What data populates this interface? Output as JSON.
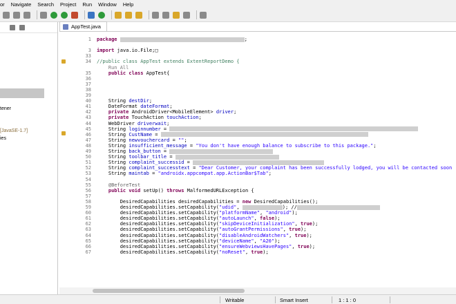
{
  "menu": [
    "or",
    "Navigate",
    "Search",
    "Project",
    "Run",
    "Window",
    "Help"
  ],
  "left_pane": {
    "items": [
      "tener",
      "[JavaSE-1.7]",
      "ies"
    ]
  },
  "editor": {
    "tab_label": "AppTest.java",
    "lines": [
      {
        "n": "1",
        "segs": [
          [
            "kw",
            "package"
          ],
          [
            "plain",
            " "
          ],
          [
            "blur",
            "180"
          ],
          [
            "plain",
            ";"
          ]
        ]
      },
      {
        "n": "",
        "segs": []
      },
      {
        "n": "3",
        "segs": [
          [
            "kw",
            "import"
          ],
          [
            "plain",
            " java.io.File;"
          ],
          [
            "plain",
            "□"
          ]
        ]
      },
      {
        "n": "33",
        "segs": []
      },
      {
        "n": "34",
        "segs": [
          [
            "com",
            "//public class AppTest extends ExtentReportDemo {"
          ]
        ]
      },
      {
        "n": "",
        "segs": [
          [
            "gray",
            "    Run All"
          ]
        ]
      },
      {
        "n": "35",
        "segs": [
          [
            "plain",
            "    "
          ],
          [
            "kw",
            "public class"
          ],
          [
            "plain",
            " AppTest{"
          ]
        ]
      },
      {
        "n": "36",
        "segs": []
      },
      {
        "n": "37",
        "segs": []
      },
      {
        "n": "38",
        "segs": []
      },
      {
        "n": "39",
        "segs": []
      },
      {
        "n": "40",
        "segs": [
          [
            "plain",
            "    String "
          ],
          [
            "fld",
            "destDir"
          ],
          [
            "plain",
            ";"
          ]
        ]
      },
      {
        "n": "41",
        "segs": [
          [
            "plain",
            "    DateFormat "
          ],
          [
            "fld",
            "dateFormat"
          ],
          [
            "plain",
            ";"
          ]
        ]
      },
      {
        "n": "42",
        "segs": [
          [
            "plain",
            "    "
          ],
          [
            "kw",
            "private"
          ],
          [
            "plain",
            " AndroidDriver<MobileElement> "
          ],
          [
            "fld",
            "driver"
          ],
          [
            "plain",
            ";"
          ]
        ]
      },
      {
        "n": "43",
        "segs": [
          [
            "plain",
            "    "
          ],
          [
            "kw",
            "private"
          ],
          [
            "plain",
            " TouchAction "
          ],
          [
            "fld",
            "touchAction"
          ],
          [
            "plain",
            ";"
          ]
        ]
      },
      {
        "n": "44",
        "segs": [
          [
            "plain",
            "    WebDriver "
          ],
          [
            "fld",
            "driverwait"
          ],
          [
            "plain",
            ";"
          ]
        ]
      },
      {
        "n": "45",
        "segs": [
          [
            "plain",
            "    String "
          ],
          [
            "fld",
            "loginnumber"
          ],
          [
            "plain",
            " = "
          ],
          [
            "blur",
            "360"
          ]
        ]
      },
      {
        "n": "46",
        "segs": [
          [
            "plain",
            "    String "
          ],
          [
            "fld",
            "CustName"
          ],
          [
            "plain",
            " = "
          ],
          [
            "blur",
            "300"
          ]
        ]
      },
      {
        "n": "47",
        "segs": [
          [
            "plain",
            "    String "
          ],
          [
            "fld",
            "newvouchercard"
          ],
          [
            "plain",
            " = "
          ],
          [
            "str",
            "\"\""
          ],
          [
            "plain",
            ";"
          ]
        ]
      },
      {
        "n": "48",
        "segs": [
          [
            "plain",
            "    String "
          ],
          [
            "fld",
            "insufficient_message"
          ],
          [
            "plain",
            " = "
          ],
          [
            "str",
            "\"You don't have enough balance to subscribe to this package.\""
          ],
          [
            "plain",
            ";"
          ]
        ]
      },
      {
        "n": "49",
        "segs": [
          [
            "plain",
            "    String "
          ],
          [
            "fld",
            "back_button"
          ],
          [
            "plain",
            " = "
          ],
          [
            "blur",
            "150"
          ]
        ]
      },
      {
        "n": "50",
        "segs": [
          [
            "plain",
            "    String "
          ],
          [
            "fld",
            "toolbar_title"
          ],
          [
            "plain",
            " = "
          ],
          [
            "blur",
            "150"
          ]
        ]
      },
      {
        "n": "51",
        "segs": [
          [
            "plain",
            "    String "
          ],
          [
            "fld",
            "complaint_successid"
          ],
          [
            "plain",
            " = "
          ],
          [
            "blur",
            "190"
          ]
        ]
      },
      {
        "n": "52",
        "segs": [
          [
            "plain",
            "    String "
          ],
          [
            "fld",
            "complaint_successtext"
          ],
          [
            "plain",
            " = "
          ],
          [
            "str",
            "\"Dear Customer, your complaint has been successfully lodged, you will be contacted soon"
          ]
        ]
      },
      {
        "n": "53",
        "segs": [
          [
            "plain",
            "    String "
          ],
          [
            "fld",
            "maintab"
          ],
          [
            "plain",
            " = "
          ],
          [
            "str",
            "\"androidx.appcompat.app.ActionBar$Tab\""
          ],
          [
            "plain",
            ";"
          ]
        ]
      },
      {
        "n": "54",
        "segs": []
      },
      {
        "n": "55",
        "segs": [
          [
            "plain",
            "    "
          ],
          [
            "ann",
            "@BeforeTest"
          ]
        ]
      },
      {
        "n": "56",
        "segs": [
          [
            "plain",
            "    "
          ],
          [
            "kw",
            "public void"
          ],
          [
            "plain",
            " setUp() "
          ],
          [
            "kw",
            "throws"
          ],
          [
            "plain",
            " MalformedURLException {"
          ]
        ]
      },
      {
        "n": "57",
        "segs": []
      },
      {
        "n": "58",
        "segs": [
          [
            "plain",
            "        DesiredCapabilities "
          ],
          [
            "plain",
            "desiredCapabilities"
          ],
          [
            "plain",
            " = "
          ],
          [
            "kw",
            "new"
          ],
          [
            "plain",
            " DesiredCapabilities();"
          ]
        ]
      },
      {
        "n": "59",
        "segs": [
          [
            "plain",
            "        desiredCapabilities.setCapability("
          ],
          [
            "str",
            "\"udid\""
          ],
          [
            "plain",
            ", "
          ],
          [
            "blur",
            "58"
          ],
          [
            "plain",
            "); //"
          ],
          [
            "blur",
            "120"
          ]
        ]
      },
      {
        "n": "60",
        "segs": [
          [
            "plain",
            "        desiredCapabilities.setCapability("
          ],
          [
            "str",
            "\"platformName\""
          ],
          [
            "plain",
            ", "
          ],
          [
            "str",
            "\"android\""
          ],
          [
            "plain",
            ");"
          ]
        ]
      },
      {
        "n": "61",
        "segs": [
          [
            "plain",
            "        desiredCapabilities.setCapability("
          ],
          [
            "str",
            "\"autoLaunch\""
          ],
          [
            "plain",
            ", "
          ],
          [
            "kw",
            "false"
          ],
          [
            "plain",
            ");"
          ]
        ]
      },
      {
        "n": "62",
        "segs": [
          [
            "plain",
            "        desiredCapabilities.setCapability("
          ],
          [
            "str",
            "\"skipDeviceInitialization\""
          ],
          [
            "plain",
            ", "
          ],
          [
            "kw",
            "true"
          ],
          [
            "plain",
            ");"
          ]
        ]
      },
      {
        "n": "63",
        "segs": [
          [
            "plain",
            "        desiredCapabilities.setCapability("
          ],
          [
            "str",
            "\"autoGrantPermissions\""
          ],
          [
            "plain",
            ", "
          ],
          [
            "kw",
            "true"
          ],
          [
            "plain",
            ");"
          ]
        ]
      },
      {
        "n": "64",
        "segs": [
          [
            "plain",
            "        desiredCapabilities.setCapability("
          ],
          [
            "str",
            "\"disableAndroidWatchers\""
          ],
          [
            "plain",
            ", "
          ],
          [
            "kw",
            "true"
          ],
          [
            "plain",
            ");"
          ]
        ]
      },
      {
        "n": "65",
        "segs": [
          [
            "plain",
            "        desiredCapabilities.setCapability("
          ],
          [
            "str",
            "\"deviceName\""
          ],
          [
            "plain",
            ", "
          ],
          [
            "str",
            "\"A20\""
          ],
          [
            "plain",
            ");"
          ]
        ]
      },
      {
        "n": "66",
        "segs": [
          [
            "plain",
            "        desiredCapabilities.setCapability("
          ],
          [
            "str",
            "\"ensureWebviewsHavePages\""
          ],
          [
            "plain",
            ", "
          ],
          [
            "kw",
            "true"
          ],
          [
            "plain",
            ");"
          ]
        ]
      },
      {
        "n": "67",
        "segs": [
          [
            "plain",
            "        desiredCapabilities.setCapability("
          ],
          [
            "str",
            "\"noReset\""
          ],
          [
            "plain",
            ", "
          ],
          [
            "kw",
            "true"
          ],
          [
            "plain",
            ");"
          ]
        ]
      }
    ]
  },
  "status": {
    "writable": "Writable",
    "insert_mode": "Smart Insert",
    "position": "1 : 1 : 0"
  },
  "icons": [
    "save-icon",
    "debug-icon",
    "run-icon",
    "external-tools-icon",
    "new-java-class-icon",
    "open-type-icon",
    "search-icon",
    "back-icon",
    "forward-icon",
    "maximize-icon"
  ]
}
